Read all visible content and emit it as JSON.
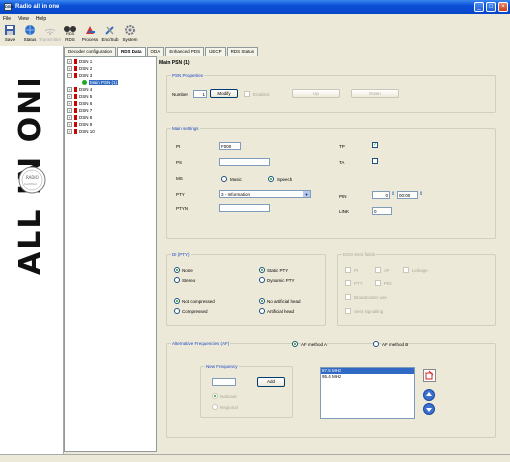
{
  "window": {
    "title": "Radio all in one",
    "app_icon": "DSN"
  },
  "menu": [
    "File",
    "View",
    "Help"
  ],
  "toolbar": [
    {
      "label": "Save",
      "icon": "save-icon",
      "enabled": true
    },
    {
      "label": "Status",
      "icon": "globe-icon",
      "enabled": true
    },
    {
      "label": "Transmitter",
      "icon": "transmitter-icon",
      "enabled": false
    },
    {
      "label": "RDS",
      "icon": "rds-icon",
      "enabled": true
    },
    {
      "label": "Process",
      "icon": "process-icon",
      "enabled": true
    },
    {
      "label": "Enc/Sub",
      "icon": "tools-icon",
      "enabled": true
    },
    {
      "label": "System",
      "icon": "system-gear-icon",
      "enabled": true
    }
  ],
  "logo": {
    "text": "ALL IN ONE",
    "badge": "RADIO",
    "badge2": "Certified"
  },
  "tabs": [
    "Decoder configuration",
    "RDS Data",
    "ODA",
    "Enhanced PDS",
    "UECP",
    "RDS Status"
  ],
  "tree": {
    "nodes": [
      "DSN 1",
      "DSN 2",
      "DSN 3",
      "Main PSN (1)",
      "DSN 4",
      "DSN 5",
      "DSN 6",
      "DSN 7",
      "DSN 8",
      "DSN 9",
      "DSN 10"
    ]
  },
  "main": {
    "title": "Main PSN (1)",
    "psn": {
      "title": "PSN Properties",
      "number_label": "Number",
      "number": "1",
      "modify": "Modify",
      "enabled": "Enabled",
      "up": "Up",
      "down": "Down"
    },
    "settings": {
      "title": "Main settings",
      "pi_label": "PI",
      "pi": "F000",
      "ps_label": "PS",
      "ps": "",
      "ms_label": "MS",
      "music": "Music",
      "speech": "Speech",
      "pty_label": "PTY",
      "pty": "3 - Information",
      "ptyn_label": "PTYN",
      "ptyn": "",
      "tp_label": "TP",
      "ta_label": "TA",
      "pin_label": "PIN",
      "pin_day": "0",
      "pin_time": "00:00",
      "link_label": "LINK",
      "link": "0"
    },
    "di": {
      "title": "DI (PTY)",
      "none": "None",
      "stereo": "Stereo",
      "static_pty": "Static PTY",
      "dynamic_pty": "Dynamic PTY",
      "not_compressed": "Not compressed",
      "compressed": "Compressed",
      "no_artificial_head": "No artificial head",
      "artificial_head": "Artificial head"
    },
    "eon": {
      "title": "EON Sent fields",
      "pi": "PI",
      "af": "AF",
      "linkage": "Linkage",
      "pty": "PTY",
      "pin": "PIN",
      "broadcaster": "Broadcaster use",
      "sent": "Sent signalling"
    },
    "af": {
      "title": "Alternative Frequencies (AF)",
      "method_a": "AF method A",
      "method_b": "AF method B",
      "new_freq": "New Frequency",
      "add": "Add",
      "national": "National",
      "regional": "Regional",
      "list": [
        "87.5 MHz",
        "95.4 MHz"
      ]
    }
  }
}
